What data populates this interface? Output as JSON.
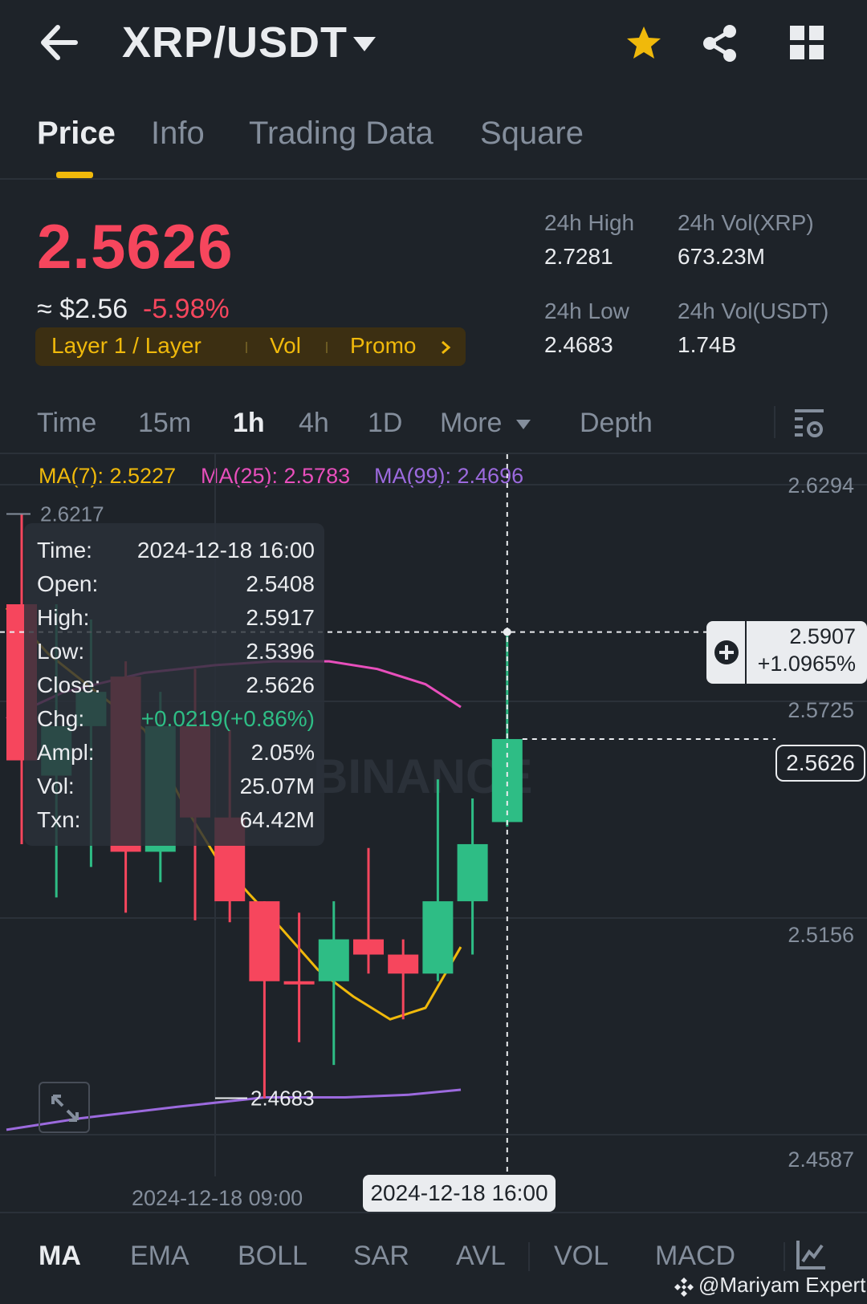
{
  "header": {
    "pair": "XRP/USDT",
    "back_icon": "back-arrow-icon",
    "favorite_icon": "star-icon",
    "share_icon": "share-icon",
    "menu_icon": "grid-icon",
    "favorite_color": "#f0b90b"
  },
  "tabs": [
    {
      "label": "Price",
      "active": true
    },
    {
      "label": "Info",
      "active": false
    },
    {
      "label": "Trading Data",
      "active": false
    },
    {
      "label": "Square",
      "active": false
    }
  ],
  "ticker": {
    "last_price": "2.5626",
    "approx_usd": "≈ $2.56",
    "change_pct": "-5.98%",
    "tags": [
      "Layer 1 / Layer",
      "Vol",
      "Promo"
    ],
    "high_label": "24h High",
    "high_value": "2.7281",
    "low_label": "24h Low",
    "low_value": "2.4683",
    "vol_xrp_label": "24h Vol(XRP)",
    "vol_xrp_value": "673.23M",
    "vol_usdt_label": "24h Vol(USDT)",
    "vol_usdt_value": "1.74B"
  },
  "intervals": {
    "items": [
      "Time",
      "15m",
      "1h",
      "4h",
      "1D",
      "More"
    ],
    "active": "1h",
    "depth": "Depth",
    "settings_icon": "chart-settings-icon"
  },
  "ma": {
    "ma7": "MA(7): 2.5227",
    "ma25": "MA(25): 2.5783",
    "ma99": "MA(99): 2.4696",
    "ma7_color": "#f0b90b",
    "ma25_color": "#e84fbc",
    "ma99_color": "#9c6ade"
  },
  "tooltip": {
    "rows": [
      {
        "k": "Time:",
        "v": "2024-12-18 16:00"
      },
      {
        "k": "Open:",
        "v": "2.5408"
      },
      {
        "k": "High:",
        "v": "2.5917"
      },
      {
        "k": "Low:",
        "v": "2.5396"
      },
      {
        "k": "Close:",
        "v": "2.5626"
      },
      {
        "k": "Chg:",
        "v": "+0.0219(+0.86%)"
      },
      {
        "k": "Ampl:",
        "v": "2.05%"
      },
      {
        "k": "Vol:",
        "v": "25.07M"
      },
      {
        "k": "Txn:",
        "v": "64.42M"
      }
    ],
    "chg_color": "#2ebd85"
  },
  "chart_meta": {
    "crosshair_price": "2.5907",
    "crosshair_pct": "+1.0965%",
    "current_price_tag": "2.5626",
    "axis_labels": [
      "2.6294",
      "2.5725",
      "2.5156",
      "2.4587"
    ],
    "high_marker": "2.6217",
    "low_marker": "2.4683",
    "time_label_left": "2024-12-18 09:00",
    "time_label_cursor": "2024-12-18 16:00",
    "watermark_brand": "BINANCE",
    "up_color": "#2ebd85",
    "down_color": "#f6465d",
    "candles": [
      {
        "o": 2.598,
        "h": 2.6217,
        "l": 2.535,
        "c": 2.557,
        "up": false
      },
      {
        "o": 2.553,
        "h": 2.598,
        "l": 2.521,
        "c": 2.566,
        "up": true
      },
      {
        "o": 2.566,
        "h": 2.594,
        "l": 2.529,
        "c": 2.575,
        "up": true
      },
      {
        "o": 2.579,
        "h": 2.583,
        "l": 2.517,
        "c": 2.533,
        "up": false
      },
      {
        "o": 2.566,
        "h": 2.575,
        "l": 2.525,
        "c": 2.533,
        "up": true
      },
      {
        "o": 2.566,
        "h": 2.581,
        "l": 2.515,
        "c": 2.542,
        "up": false
      },
      {
        "o": 2.542,
        "h": 2.565,
        "l": 2.5145,
        "c": 2.52,
        "up": false
      },
      {
        "o": 2.52,
        "h": 2.52,
        "l": 2.4683,
        "c": 2.499,
        "up": false
      },
      {
        "o": 2.499,
        "h": 2.517,
        "l": 2.483,
        "c": 2.499,
        "up": false
      },
      {
        "o": 2.499,
        "h": 2.52,
        "l": 2.477,
        "c": 2.51,
        "up": true
      },
      {
        "o": 2.51,
        "h": 2.534,
        "l": 2.501,
        "c": 2.506,
        "up": false
      },
      {
        "o": 2.506,
        "h": 2.51,
        "l": 2.489,
        "c": 2.501,
        "up": false
      },
      {
        "o": 2.501,
        "h": 2.552,
        "l": 2.499,
        "c": 2.52,
        "up": true
      },
      {
        "o": 2.52,
        "h": 2.547,
        "l": 2.506,
        "c": 2.535,
        "up": true
      },
      {
        "o": 2.5408,
        "h": 2.5917,
        "l": 2.5396,
        "c": 2.5626,
        "up": true
      }
    ]
  },
  "indicators": {
    "items": [
      "MA",
      "EMA",
      "BOLL",
      "SAR",
      "AVL",
      "VOL",
      "MACD"
    ],
    "active": "MA",
    "chart_icon": "indicator-chart-icon"
  },
  "credit": "@Mariyam Expert"
}
